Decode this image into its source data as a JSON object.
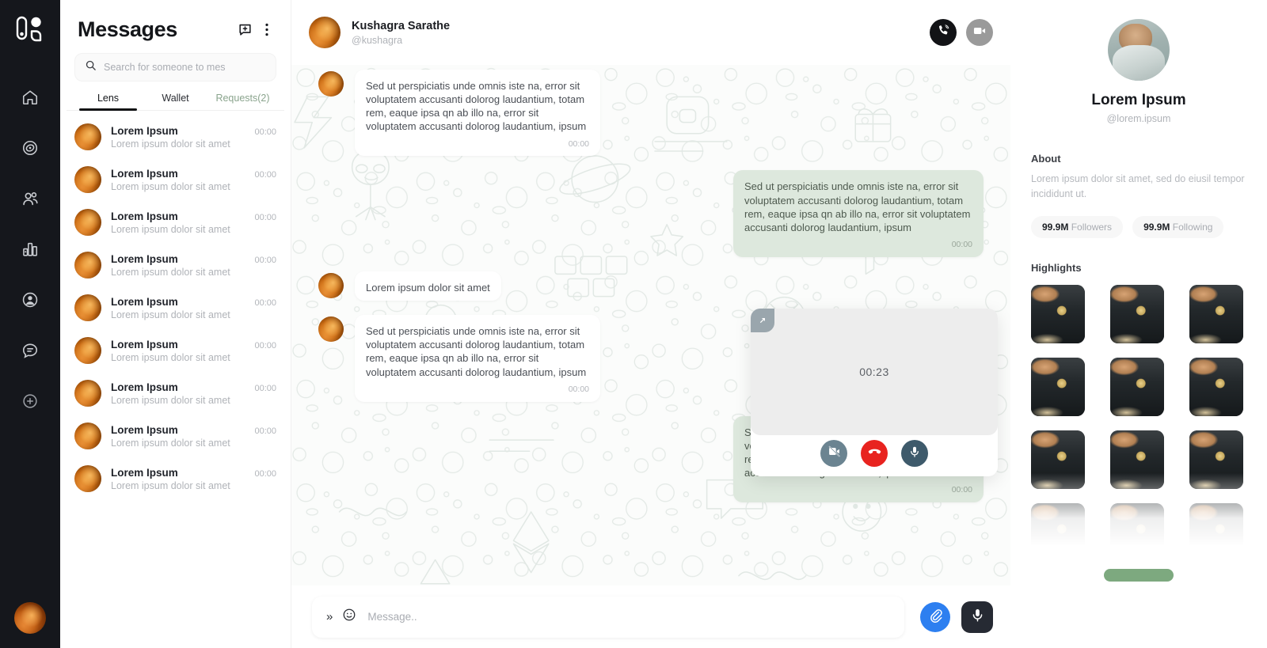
{
  "rail": {
    "logo_name": "app-logo",
    "items": [
      {
        "icon": "home-icon",
        "name": "home"
      },
      {
        "icon": "compass-icon",
        "name": "explore"
      },
      {
        "icon": "people-icon",
        "name": "communities"
      },
      {
        "icon": "leaderboard-icon",
        "name": "leaderboard"
      },
      {
        "icon": "profile-icon",
        "name": "profile"
      },
      {
        "icon": "chat-icon",
        "name": "messages"
      },
      {
        "icon": "plus-circle-icon",
        "name": "create"
      }
    ]
  },
  "conversations_panel": {
    "title": "Messages",
    "new_message_icon": "new-message-icon",
    "more_icon": "more-vertical-icon",
    "search": {
      "placeholder": "Search for someone to mes",
      "value": "",
      "icon": "search-icon"
    },
    "tabs": [
      {
        "label": "Lens",
        "active": true
      },
      {
        "label": "Wallet",
        "active": false
      },
      {
        "label": "Requests(2)",
        "active": false,
        "muted": true
      }
    ],
    "items": [
      {
        "name": "Lorem Ipsum",
        "time": "00:00",
        "preview": "Lorem ipsum dolor sit amet"
      },
      {
        "name": "Lorem Ipsum",
        "time": "00:00",
        "preview": "Lorem ipsum dolor sit amet"
      },
      {
        "name": "Lorem Ipsum",
        "time": "00:00",
        "preview": "Lorem ipsum dolor sit amet"
      },
      {
        "name": "Lorem Ipsum",
        "time": "00:00",
        "preview": "Lorem ipsum dolor sit amet"
      },
      {
        "name": "Lorem Ipsum",
        "time": "00:00",
        "preview": "Lorem ipsum dolor sit amet"
      },
      {
        "name": "Lorem Ipsum",
        "time": "00:00",
        "preview": "Lorem ipsum dolor sit amet"
      },
      {
        "name": "Lorem Ipsum",
        "time": "00:00",
        "preview": "Lorem ipsum dolor sit amet"
      },
      {
        "name": "Lorem Ipsum",
        "time": "00:00",
        "preview": "Lorem ipsum dolor sit amet"
      },
      {
        "name": "Lorem Ipsum",
        "time": "00:00",
        "preview": "Lorem ipsum dolor sit amet"
      }
    ]
  },
  "chat": {
    "header": {
      "name": "Kushagra Sarathe",
      "handle": "@kushagra",
      "voice_call_icon": "phone-call-icon",
      "video_call_icon": "video-camera-icon"
    },
    "messages": [
      {
        "dir": "in",
        "text": "Sed ut perspiciatis unde omnis iste na, error sit voluptatem accusanti dolorog laudantium, totam rem, eaque ipsa qn ab illo na, error sit voluptatem accusanti dolorog laudantium, ipsum",
        "time": "00:00"
      },
      {
        "dir": "out",
        "text": "Sed ut perspiciatis unde omnis iste na, error sit voluptatem accusanti dolorog laudantium, totam rem, eaque ipsa qn ab illo na, error sit voluptatem accusanti dolorog laudantium, ipsum",
        "time": "00:00"
      },
      {
        "dir": "in",
        "text": "Lorem ipsum dolor sit amet",
        "time": ""
      },
      {
        "dir": "in",
        "text": "Sed ut perspiciatis unde omnis iste na, error sit voluptatem accusanti dolorog laudantium, totam rem, eaque ipsa qn ab illo na, error sit voluptatem accusanti dolorog laudantium, ipsum",
        "time": "00:00"
      },
      {
        "dir": "out",
        "text": "Sed ut perspiciatis unde omnis iste na, error sit voluptatem accusanti dolorog laudantium, totam rem, eaque ipsa qn ab illo na, error sit voluptatem accusanti dolorog laudantium, ipsum",
        "time": "00:00"
      }
    ],
    "composer": {
      "expand_icon": "chevron-double-right-icon",
      "expand_label": "»",
      "emoji_icon": "emoji-icon",
      "placeholder": "Message..",
      "value": "",
      "attach_icon": "paperclip-icon",
      "mic_icon": "microphone-icon"
    }
  },
  "call_overlay": {
    "timer": "00:23",
    "resize_icon": "resize-handle-icon",
    "buttons": [
      {
        "name": "camera-off-button",
        "icon": "video-off-icon",
        "color": "#6b8491"
      },
      {
        "name": "end-call-button",
        "icon": "phone-hangup-icon",
        "color": "#e8231f"
      },
      {
        "name": "microphone-button",
        "icon": "microphone-icon",
        "color": "#3e5a6b"
      }
    ]
  },
  "profile_panel": {
    "avatar_name": "profile-avatar",
    "name": "Lorem Ipsum",
    "handle": "@lorem.ipsum",
    "about_title": "About",
    "about_text": "Lorem ipsum dolor sit amet, sed do eiusil tempor incididunt ut.",
    "stats": [
      {
        "value": "99.9M",
        "label": "Followers"
      },
      {
        "value": "99.9M",
        "label": "Following"
      }
    ],
    "highlights_title": "Highlights",
    "highlights_count": 12,
    "cta_name": "load-more-button"
  },
  "colors": {
    "rail_bg": "#15171c",
    "accent_green": "#7da97f",
    "bubble_out": "#dde8dd",
    "attach_blue": "#2d7ff0",
    "end_call_red": "#e8231f"
  }
}
